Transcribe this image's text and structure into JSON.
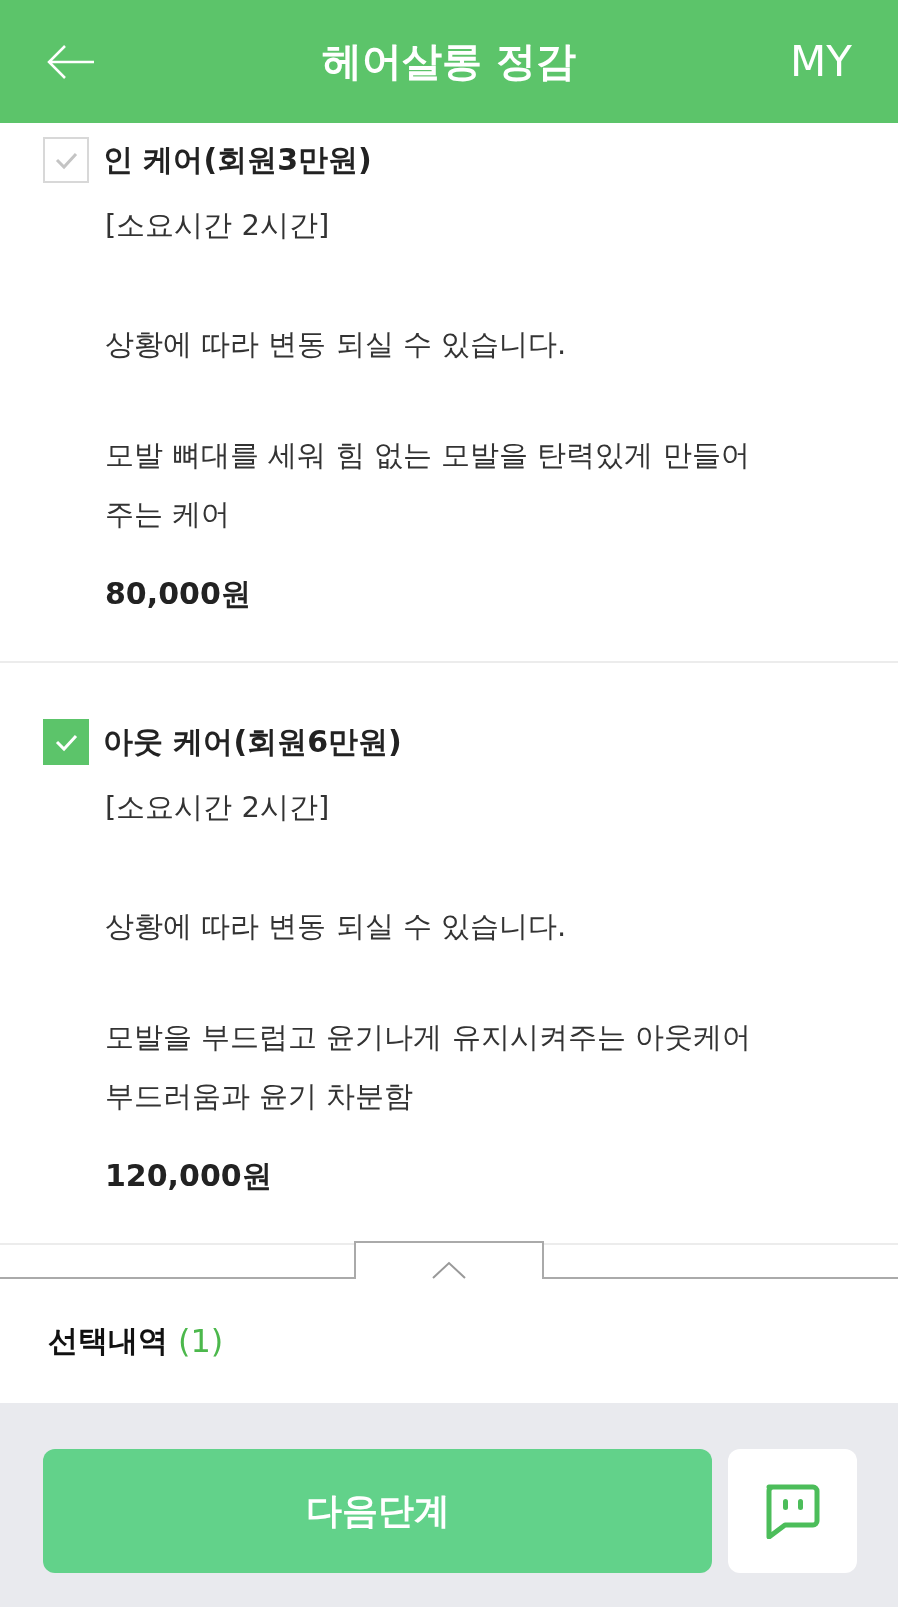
{
  "header": {
    "title": "헤어살롱 정감",
    "right_label": "MY"
  },
  "items": [
    {
      "title": "인 케어(회원3만원)",
      "checked": false,
      "duration": "[소요시간 2시간]",
      "note": "상황에 따라 변동 되실 수 있습니다.",
      "description": [
        "모발 뼈대를 세워 힘 없는 모발을 탄력있게 만들어",
        "주는 케어"
      ],
      "price": "80,000원"
    },
    {
      "title": "아웃 케어(회원6만원)",
      "checked": true,
      "duration": "[소요시간 2시간]",
      "note": "상황에 따라 변동 되실 수 있습니다.",
      "description": [
        "모발을 부드럽고 윤기나게 유지시켜주는 아웃케어",
        "부드러움과 윤기 차분함"
      ],
      "price": "120,000원"
    }
  ],
  "selection": {
    "label": "선택내역",
    "count": "(1)"
  },
  "next_button": "다음단계"
}
